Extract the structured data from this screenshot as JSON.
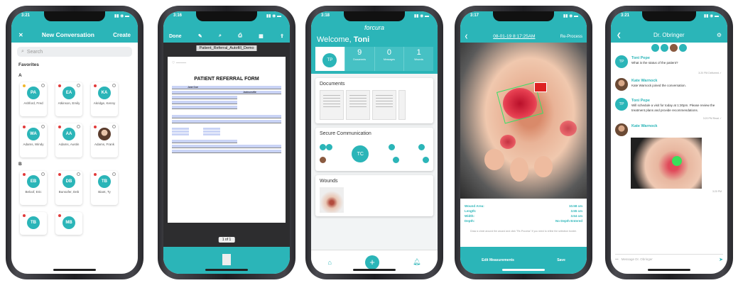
{
  "phone1": {
    "time": "3:21",
    "close": "✕",
    "title": "New Conversation",
    "action": "Create",
    "search_placeholder": "Search",
    "favorites": "Favorites",
    "section_a": "A",
    "section_b": "B",
    "contacts_a": [
      {
        "initials": "PA",
        "name": "Ashford, Fred"
      },
      {
        "initials": "EA",
        "name": "Atkinson, Emily"
      },
      {
        "initials": "KA",
        "name": "Akridge, Kenny"
      },
      {
        "initials": "WA",
        "name": "Adams, Windy"
      },
      {
        "initials": "AA",
        "name": "Adams, Austin"
      },
      {
        "initials": "",
        "name": "Adams, Frank"
      }
    ],
    "contacts_b": [
      {
        "initials": "EB",
        "name": "Beloof, Eric"
      },
      {
        "initials": "DB",
        "name": "Bunsofer, Deb"
      },
      {
        "initials": "TB",
        "name": "Biant, Ty"
      },
      {
        "initials": "TB",
        "name": ""
      },
      {
        "initials": "MB",
        "name": ""
      }
    ]
  },
  "phone2": {
    "time": "3:16",
    "done": "Done",
    "filename": "Patient_Referral_Autofill_Demo",
    "form_title": "PATIENT REFERRAL FORM",
    "patient_name": "Jane Doe",
    "city": "Jacksonville",
    "page": "1 of 1"
  },
  "phone3": {
    "time": "3:18",
    "brand": "forcura",
    "welcome": "Welcome,",
    "user": "Toni",
    "avatar": "TP",
    "stats": [
      {
        "value": "9",
        "label": "Documents"
      },
      {
        "value": "0",
        "label": "Messages"
      },
      {
        "value": "1",
        "label": "Wounds"
      }
    ],
    "documents": "Documents",
    "secure": "Secure Communication",
    "tc": "TC",
    "wounds": "Wounds",
    "plus": "+"
  },
  "phone4": {
    "time": "3:17",
    "date": "08-01-19 8:17:25AM",
    "reprocess": "Re-Process",
    "measurements": [
      {
        "label": "Wound Area:",
        "value": "10.58 cm"
      },
      {
        "label": "Length:",
        "value": "3.55 cm"
      },
      {
        "label": "Width:",
        "value": "3.54 cm"
      },
      {
        "label": "Depth:",
        "value": "No Depth Entered"
      }
    ],
    "hint": "Draw a circle around the wound and click \"Re-Process\" if you need to refine the selection border.",
    "edit": "Edit Measurements",
    "save": "Save"
  },
  "phone5": {
    "time": "3:21",
    "title": "Dr. Obringer",
    "messages": [
      {
        "avatar": "TP",
        "name": "Toni Pepe",
        "text": "What is the status of the patient?",
        "time": "3:20 PM Delivered ✓"
      },
      {
        "avatar": "",
        "name": "Kate Warnock",
        "text": "Kate Warnock joined the conversation.",
        "time": ""
      },
      {
        "avatar": "TP",
        "name": "Toni Pepe",
        "text": "Will schedule a visit for today at 1:30pm. Please review the treatment plans and provide recommendations.",
        "time": "3:20 PM Read ✓"
      },
      {
        "avatar": "",
        "name": "Kate Warnock",
        "text": "",
        "time": "3:20 PM"
      }
    ],
    "input_placeholder": "Message Dr. Obringer"
  },
  "colors": {
    "teal": "#2bb5b8",
    "red": "#e23b3b",
    "green": "#38e066"
  }
}
